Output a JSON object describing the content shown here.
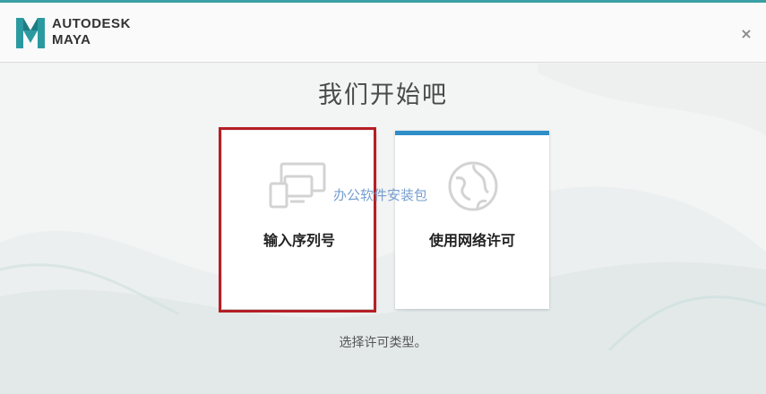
{
  "header": {
    "brand_line1": "AUTODESK",
    "brand_line2": "MAYA",
    "close_glyph": "×",
    "logo_icon": "maya-logo-icon",
    "close_icon": "close-icon"
  },
  "main": {
    "title": "我们开始吧",
    "cards": [
      {
        "label": "输入序列号",
        "icon": "devices-icon",
        "selected": true
      },
      {
        "label": "使用网络许可",
        "icon": "network-globe-icon",
        "selected": false
      }
    ],
    "footer": "选择许可类型。",
    "watermark": "办公软件安装包"
  },
  "colors": {
    "accent_bar": "#2d8ec8",
    "selection_border": "#b51f24",
    "brand_teal": "#3a9fa3"
  }
}
